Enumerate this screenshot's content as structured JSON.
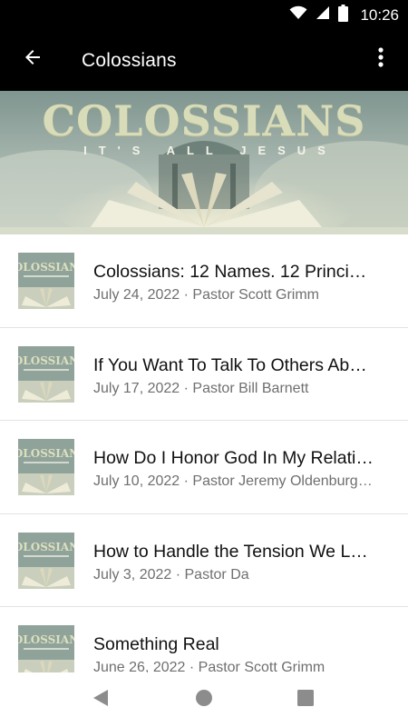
{
  "status_bar": {
    "time": "10:26",
    "icons": [
      "wifi-icon",
      "cell-signal-icon",
      "battery-icon"
    ]
  },
  "app_bar": {
    "title": "Colossians",
    "back_icon": "arrow-left-icon",
    "menu_icon": "more-vertical-icon"
  },
  "hero": {
    "title": "COLOSSIANS",
    "subtitle": "IT'S ALL JESUS"
  },
  "sermons": [
    {
      "title": "Colossians: 12 Names. 12 Princi…",
      "meta": "July 24, 2022 · Pastor Scott Grimm"
    },
    {
      "title": "If You Want To Talk To Others Ab…",
      "meta": "July 17, 2022 · Pastor Bill Barnett"
    },
    {
      "title": "How Do I Honor God In My Relati…",
      "meta": "July 10, 2022 · Pastor Jeremy Oldenburg…"
    },
    {
      "title": "How to Handle the Tension We L…",
      "meta": "July 3, 2022 · Pastor Da"
    },
    {
      "title": "Something Real",
      "meta": "June 26, 2022 · Pastor Scott Grimm"
    }
  ],
  "thumbnail_text": "OLOSSIAN",
  "nav_bar": {
    "icons": [
      "back-triangle-icon",
      "home-circle-icon",
      "recents-square-icon"
    ]
  },
  "colors": {
    "bar_background": "#000000",
    "hero_tint": "#9fb0a8",
    "title_text": "#111111",
    "meta_text": "#6f6f6f",
    "divider": "#e3e3e3"
  }
}
